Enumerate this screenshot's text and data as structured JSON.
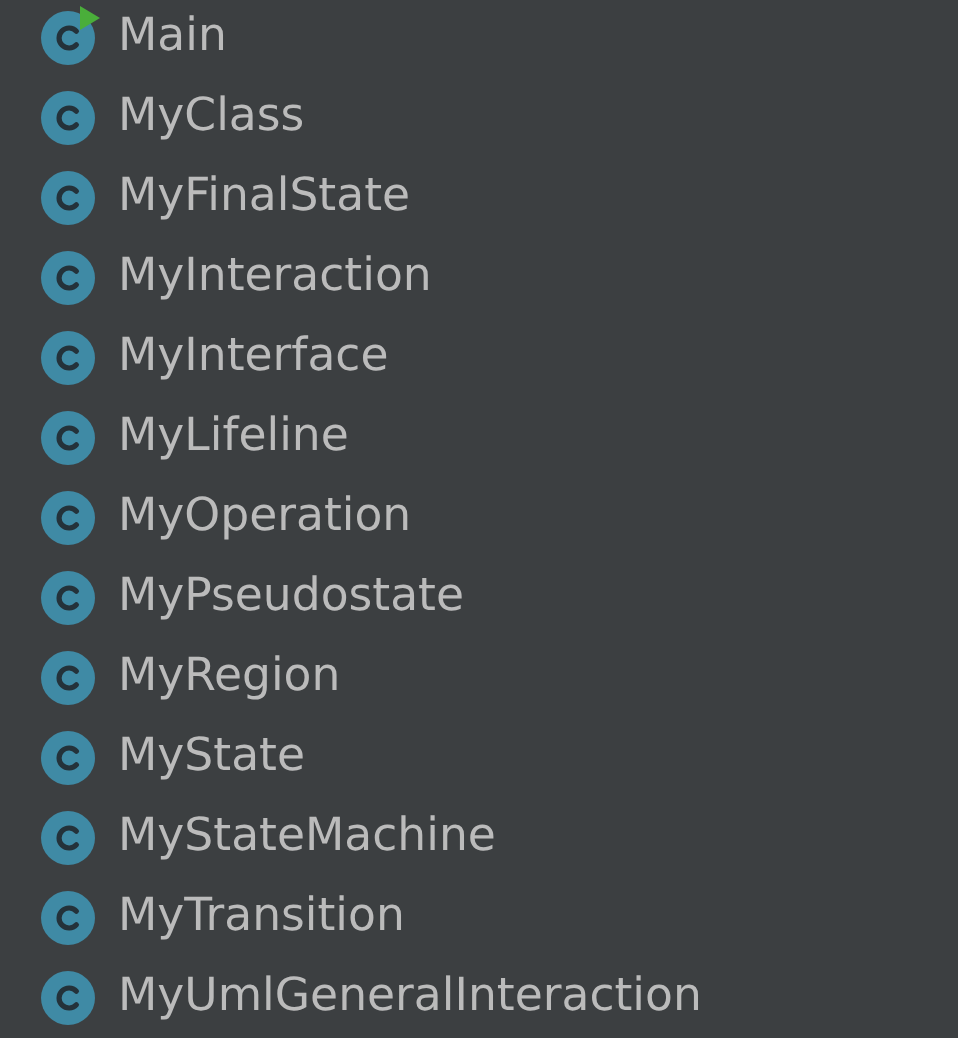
{
  "classes": [
    {
      "name": "Main",
      "runnable": true
    },
    {
      "name": "MyClass",
      "runnable": false
    },
    {
      "name": "MyFinalState",
      "runnable": false
    },
    {
      "name": "MyInteraction",
      "runnable": false
    },
    {
      "name": "MyInterface",
      "runnable": false
    },
    {
      "name": "MyLifeline",
      "runnable": false
    },
    {
      "name": "MyOperation",
      "runnable": false
    },
    {
      "name": "MyPseudostate",
      "runnable": false
    },
    {
      "name": "MyRegion",
      "runnable": false
    },
    {
      "name": "MyState",
      "runnable": false
    },
    {
      "name": "MyStateMachine",
      "runnable": false
    },
    {
      "name": "MyTransition",
      "runnable": false
    },
    {
      "name": "MyUmlGeneralInteraction",
      "runnable": false
    }
  ]
}
